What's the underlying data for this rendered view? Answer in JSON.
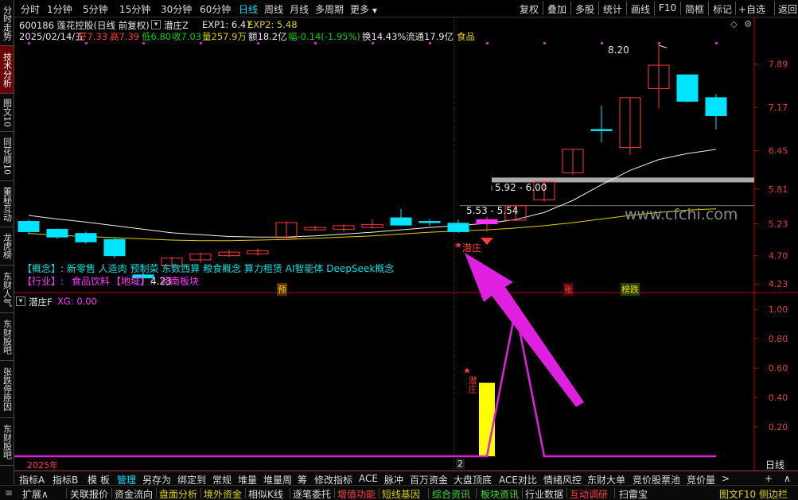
{
  "left_tabs": [
    "分时走势",
    "技术分析",
    "图文10",
    "同花顺10",
    "董秘互动",
    "龙虎榜",
    "东财人气",
    "东财股吧",
    "张跌停原因",
    "东财股吧"
  ],
  "periods": [
    "分时",
    "1分钟",
    "5分钟",
    "15分钟",
    "30分钟",
    "60分钟",
    "日线",
    "周线",
    "月线",
    "多周期",
    "更多"
  ],
  "active_period": "日线",
  "right_buttons": [
    "复权",
    "叠加",
    "多股",
    "统计",
    "画线",
    "F10",
    "简框",
    "标记",
    "+自选",
    "返回"
  ],
  "header": {
    "code_name": "600186 莲花控股(日线 前复权)",
    "indicator_name": "潜庄Z",
    "exp1": "EXP1: 6.47",
    "exp2": "EXP2: 5.48",
    "date": "2025/02/14/五",
    "open": "开7.33",
    "high": "高7.39",
    "low": "低6.80",
    "close": "收7.03",
    "volume": "量257.9万",
    "amount": "额18.2亿",
    "change": "幅-0.14(-1.95%)",
    "turnover": "换14.43%",
    "float_cap": "流通17.9亿",
    "sector": "食品"
  },
  "annotations": {
    "high_label": "8.20",
    "low_label": "4.23",
    "zone_upper": "5.92 - 6.00",
    "zone_lower": "5.53 - 5.54",
    "watermark": "www.cfchi.com",
    "marker_label": "潜庄",
    "concept_line": "【概念】: 新零售 人造肉 预制菜 东数西算 粮食概念 算力租赁 AI智能体 DeepSeek概念",
    "industry_prefix": "【行业】:",
    "industry_value": "食品饮料",
    "region_prefix": "【地域】:",
    "region_value": "河南板块",
    "tag_yu": "预",
    "tag_zhang": "张",
    "tag_bangdie": "榜跌",
    "year_label": "2025年",
    "date_tick": "2",
    "period_label": "日线"
  },
  "price_axis": [
    "7.89",
    "7.17",
    "6.45",
    "5.81",
    "5.23",
    "4.70",
    "4.23"
  ],
  "sub_header": {
    "name": "潜庄F",
    "xg": "XG: 0.00"
  },
  "sub_axis": [
    "1.00",
    "0.80",
    "0.60",
    "0.40",
    "0.20"
  ],
  "bottom_tabs_1": [
    "指标A",
    "指标B",
    "模 板",
    "管理",
    "另存为",
    "绑定到",
    "常规",
    "堆量",
    "堆量周",
    "筹",
    "修改指标",
    "ACE",
    "脉冲",
    "百万资金",
    "大盘顶底",
    "ACE对比",
    "情绪风控",
    "东财大单",
    "竞价股票池",
    "竞价量"
  ],
  "active_bottom_tab": "管理",
  "bottom_tabs_2": [
    "扩展∧",
    "关联报价",
    "资金流向",
    "盘面分析",
    "境外资金",
    "相似K线",
    "逐笔委托",
    "增值功能",
    "短线基因",
    "综合资讯",
    "板块资讯",
    "行业数据",
    "互动调研",
    "扫雷宝"
  ],
  "bottom_right": "图文F10 侧边栏",
  "colors": {
    "up": "#ff3a3a",
    "down": "#00e5ff",
    "ma_white": "#f0f0f0",
    "ma_yellow": "#e0d000",
    "indicator": "#e020e0",
    "bar": "#ffff00",
    "arrow": "#e020e0"
  },
  "chart_data": {
    "type": "candlestick",
    "candles": [
      {
        "o": 5.27,
        "c": 5.1,
        "h": 5.3,
        "l": 5.05
      },
      {
        "o": 5.14,
        "c": 5.01,
        "h": 5.15,
        "l": 4.98
      },
      {
        "o": 5.07,
        "c": 4.93,
        "h": 5.1,
        "l": 4.9
      },
      {
        "o": 4.97,
        "c": 4.7,
        "h": 4.99,
        "l": 4.66
      },
      {
        "o": 4.38,
        "c": 4.33,
        "h": 4.42,
        "l": 4.23
      },
      {
        "o": 4.53,
        "c": 4.66,
        "h": 4.68,
        "l": 4.5
      },
      {
        "o": 4.63,
        "c": 4.73,
        "h": 4.75,
        "l": 4.58
      },
      {
        "o": 4.7,
        "c": 4.76,
        "h": 4.8,
        "l": 4.68
      },
      {
        "o": 4.73,
        "c": 4.78,
        "h": 4.82,
        "l": 4.7
      },
      {
        "o": 5.0,
        "c": 5.25,
        "h": 5.28,
        "l": 4.98
      },
      {
        "o": 5.13,
        "c": 5.17,
        "h": 5.2,
        "l": 5.12
      },
      {
        "o": 5.14,
        "c": 5.2,
        "h": 5.22,
        "l": 5.1
      },
      {
        "o": 5.17,
        "c": 5.22,
        "h": 5.3,
        "l": 5.15
      },
      {
        "o": 5.33,
        "c": 5.21,
        "h": 5.48,
        "l": 5.2
      },
      {
        "o": 5.27,
        "c": 5.26,
        "h": 5.31,
        "l": 5.2
      },
      {
        "o": 5.24,
        "c": 5.1,
        "h": 5.3,
        "l": 5.08
      },
      {
        "o": 5.23,
        "c": 5.3,
        "h": 5.35,
        "l": 5.1
      },
      {
        "o": 5.29,
        "c": 5.53,
        "h": 5.55,
        "l": 5.28
      },
      {
        "o": 5.63,
        "c": 5.93,
        "h": 5.95,
        "l": 5.6
      },
      {
        "o": 6.08,
        "c": 6.47,
        "h": 6.48,
        "l": 6.05
      },
      {
        "o": 6.8,
        "c": 6.79,
        "h": 7.2,
        "l": 6.58
      },
      {
        "o": 6.5,
        "c": 7.33,
        "h": 7.33,
        "l": 6.38
      },
      {
        "o": 7.48,
        "c": 7.87,
        "h": 8.2,
        "l": 7.15
      },
      {
        "o": 7.71,
        "c": 7.27,
        "h": 7.72,
        "l": 7.25
      },
      {
        "o": 7.33,
        "c": 7.03,
        "h": 7.39,
        "l": 6.8
      }
    ],
    "ma_white": [
      5.37,
      5.31,
      5.26,
      5.2,
      5.14,
      5.08,
      5.05,
      5.02,
      5.01,
      5.01,
      5.03,
      5.06,
      5.09,
      5.13,
      5.17,
      5.2,
      5.24,
      5.3,
      5.42,
      5.62,
      5.88,
      6.12,
      6.3,
      6.4,
      6.47
    ],
    "ma_yellow": [
      5.07,
      5.04,
      5.02,
      5.0,
      4.98,
      4.96,
      4.95,
      4.95,
      4.96,
      4.97,
      4.99,
      5.01,
      5.03,
      5.06,
      5.09,
      5.11,
      5.13,
      5.16,
      5.2,
      5.25,
      5.31,
      5.37,
      5.42,
      5.46,
      5.48
    ],
    "zone_upper": [
      5.92,
      6.0
    ],
    "zone_lower": [
      5.53,
      5.54
    ],
    "ylim": [
      4.1,
      8.4
    ],
    "indicator_xg": [
      0,
      0,
      0,
      0,
      0,
      0,
      0,
      0,
      0,
      0,
      0,
      0,
      0,
      0,
      0,
      0,
      0,
      1,
      0,
      0,
      0,
      0,
      0,
      0,
      0
    ],
    "indicator_bar": 0.5,
    "sub_ylim": [
      0,
      1.05
    ]
  }
}
